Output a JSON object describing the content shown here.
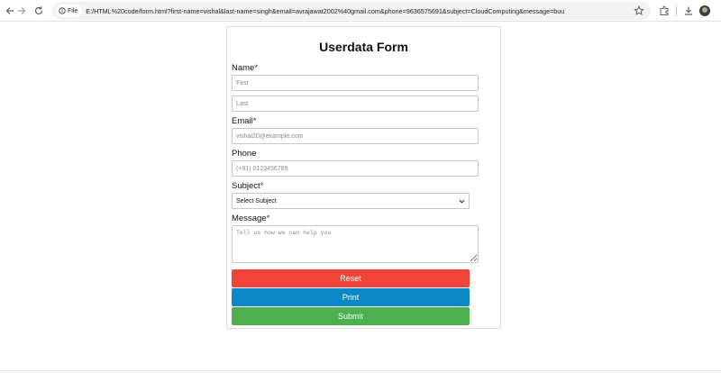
{
  "browser": {
    "file_chip_label": "File",
    "url": "E:/HTML%20code/form.html?first-name=vishal&last-name=singh&email=avrajawat2002%40gmail.com&phone=9636575691&subject=CloudComputing&message=buu",
    "icons": [
      "back-arrow-icon",
      "forward-arrow-icon",
      "reload-icon",
      "info-icon",
      "star-icon",
      "extensions-icon",
      "download-icon",
      "avatar"
    ]
  },
  "form": {
    "title": "Userdata Form",
    "name_label": "Name",
    "first_placeholder": "First",
    "last_placeholder": "Last",
    "email_label": "Email",
    "email_placeholder": "vishal20@example.com",
    "phone_label": "Phone",
    "phone_placeholder": "(+91) 0123456789",
    "subject_label": "Subject",
    "subject_selected": "Select Subject",
    "message_label": "Message",
    "message_placeholder": "Tell us how we can help you",
    "required_mark": "*",
    "reset_label": "Reset",
    "print_label": "Print",
    "submit_label": "Submit"
  },
  "colors": {
    "reset": "#f04438",
    "print": "#0a87c4",
    "submit": "#4caf50"
  }
}
